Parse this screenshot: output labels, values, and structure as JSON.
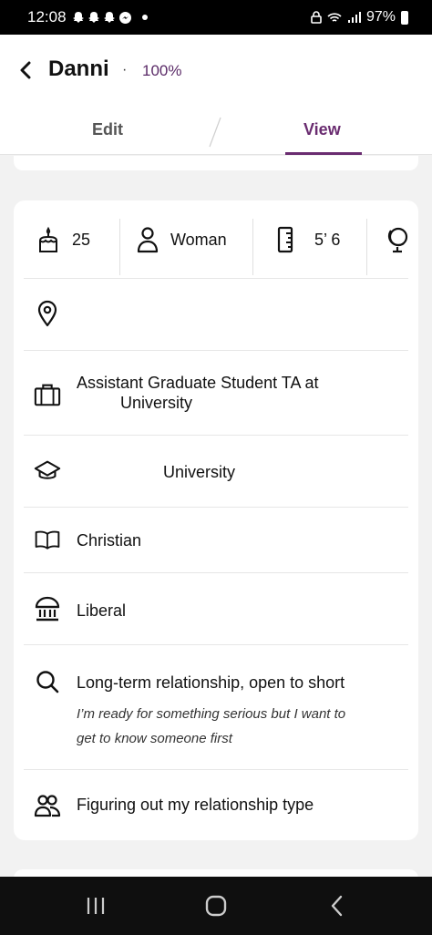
{
  "status_bar": {
    "time": "12:08",
    "notification_icons": [
      "snapchat-icon",
      "snapchat-icon",
      "snapchat-icon",
      "messenger-icon"
    ],
    "battery": "97%"
  },
  "header": {
    "title": "Danni",
    "separator": "·",
    "completion": "100%",
    "tabs": [
      {
        "label": "Edit",
        "active": false
      },
      {
        "label": "View",
        "active": true
      }
    ],
    "accent_color": "#6a2c70"
  },
  "profile": {
    "stats": [
      {
        "icon": "cake-icon",
        "value": "25"
      },
      {
        "icon": "person-icon",
        "value": "Woman"
      },
      {
        "icon": "ruler-icon",
        "value": "5’ 6"
      },
      {
        "icon": "globe-icon",
        "value": ""
      }
    ],
    "location": {
      "icon": "location-pin-icon",
      "value": ""
    },
    "job": {
      "icon": "briefcase-icon",
      "line1": "Assistant Graduate Student TA at",
      "line2": "University"
    },
    "education": {
      "icon": "graduation-cap-icon",
      "value": "University"
    },
    "religion": {
      "icon": "book-icon",
      "value": "Christian"
    },
    "politics": {
      "icon": "institution-icon",
      "value": "Liberal"
    },
    "dating_intention": {
      "icon": "search-icon",
      "value": "Long-term relationship, open to short",
      "note_line1": "I’m ready for something  serious  but  I want to",
      "note_line2": "get to know someone first"
    },
    "relationship_type": {
      "icon": "people-icon",
      "value": "Figuring out my relationship type"
    }
  },
  "nav_bar": {
    "buttons": [
      "recent-apps-icon",
      "home-icon",
      "back-icon"
    ]
  }
}
